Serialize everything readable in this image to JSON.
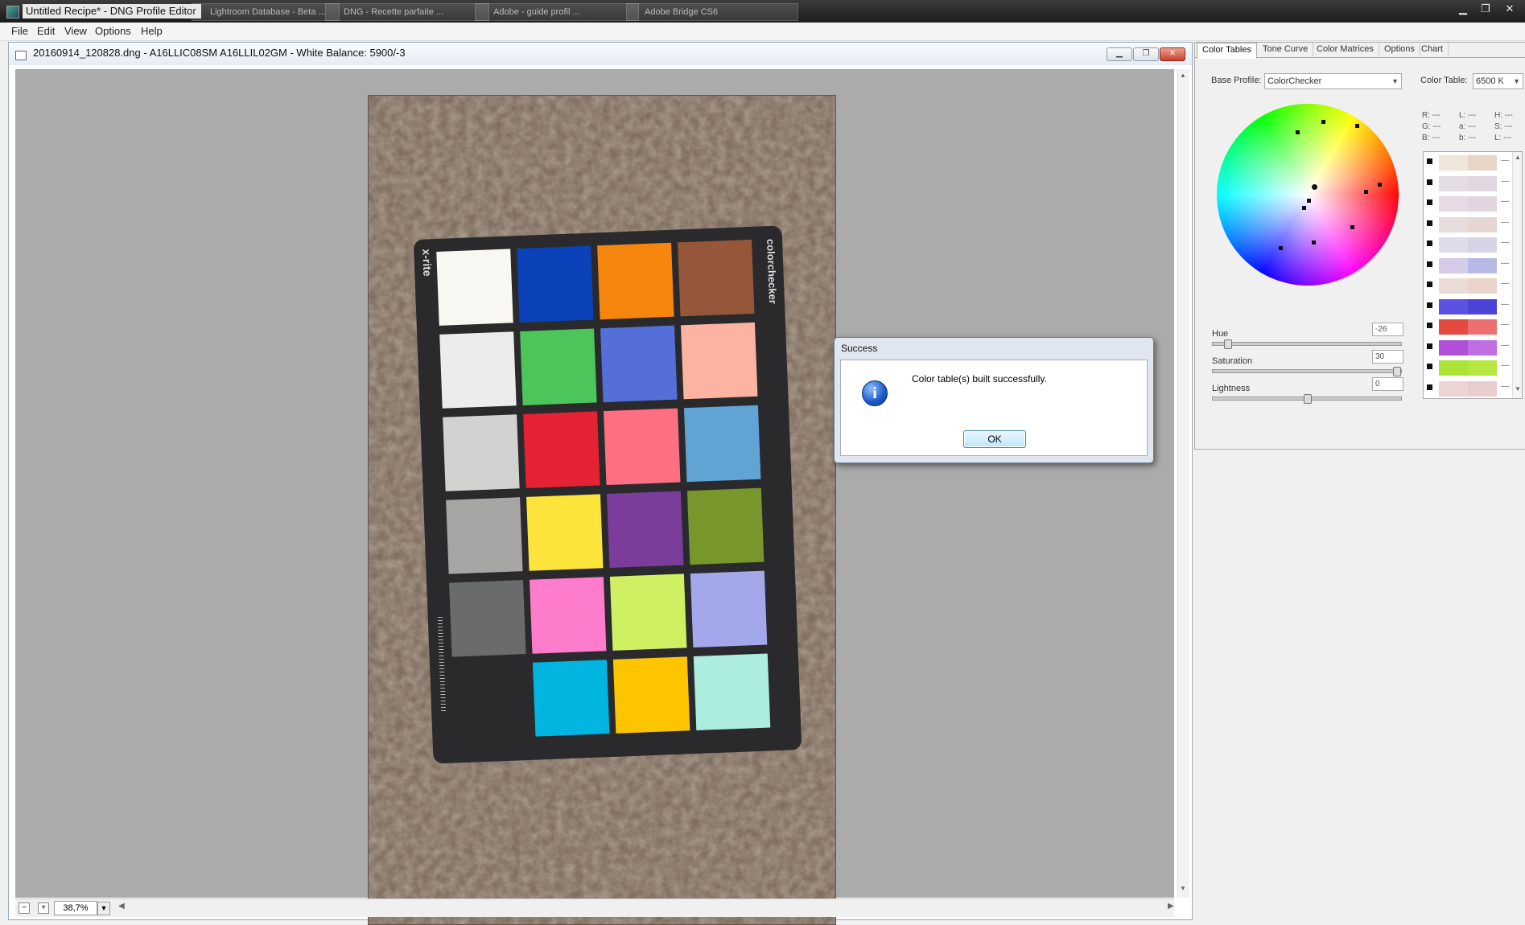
{
  "app": {
    "title": "Untitled Recipe* - DNG Profile Editor"
  },
  "taskbar_tabs": [
    "Lightroom Database - Beta ...",
    "DNG - Recette parfaite ...",
    "Adobe - guide profil ...",
    "Adobe Bridge CS6"
  ],
  "menubar": {
    "items": [
      "File",
      "Edit",
      "View",
      "Options",
      "Help"
    ]
  },
  "document": {
    "title": "20160914_120828.dng  - A16LLIC08SM A16LLIL02GM - White Balance: 5900/-3",
    "zoom": "38,7%"
  },
  "colorchecker": {
    "brand": "x-rite",
    "product": "colorchecker",
    "patches": [
      "#f8f7f2",
      "#0a43b9",
      "#f6860d",
      "#96563a",
      "#ececea",
      "#4cc65a",
      "#5470d8",
      "#fcb3a2",
      "#d2d2d0",
      "#e52234",
      "#ff6f84",
      "#5fa4d4",
      "#a7a6a4",
      "#fde43a",
      "#7b3c9c",
      "#77962b",
      "#6a6b6d",
      "#fe7ccc",
      "#d0f064",
      "#a2a8e9",
      "#2a2a2c",
      "#01b5e1",
      "#fdc500",
      "#acede0"
    ]
  },
  "dialog": {
    "title": "Success",
    "message": "Color table(s) built successfully.",
    "ok_label": "OK",
    "icon": "info-icon"
  },
  "panel": {
    "tabs": [
      "Color Tables",
      "Tone Curve",
      "Color Matrices",
      "Options",
      "Chart"
    ],
    "base_profile_label": "Base Profile:",
    "base_profile_value": "ColorChecker",
    "color_table_label": "Color Table:",
    "color_table_value": "6500 K",
    "readouts": {
      "r_label": "R:",
      "r": "---",
      "g_label": "G:",
      "g": "---",
      "b_label": "B:",
      "b": "---",
      "l_label": "L:",
      "l": "---",
      "a_label": "a:",
      "a": "---",
      "bb_label": "b:",
      "bb": "---",
      "h_label": "H:",
      "h": "---",
      "s_label": "S:",
      "s": "---",
      "l2_label": "L:",
      "l2": "---"
    },
    "hue_label": "Hue",
    "hue_value": "-26",
    "saturation_label": "Saturation",
    "saturation_value": "30",
    "lightness_label": "Lightness",
    "lightness_value": "0",
    "sliders": {
      "hue": 0.06,
      "saturation": 0.99,
      "lightness": 0.5
    },
    "swatches": [
      [
        "#eee6d9",
        "#e7d5c8"
      ],
      [
        "#e5dde5",
        "#e2d6e0"
      ],
      [
        "#e6dbe4",
        "#e2d5df"
      ],
      [
        "#e5dcde",
        "#e6d6d3"
      ],
      [
        "#e0dbe9",
        "#d8d2e6"
      ],
      [
        "#d6cbe8",
        "#b7b8e6"
      ],
      [
        "#eadcd6",
        "#ead3c8"
      ],
      [
        "#5b51e3",
        "#4c43d8"
      ],
      [
        "#e4493f",
        "#eb6f6f"
      ],
      [
        "#b14fd8",
        "#c06ce2"
      ],
      [
        "#a9e436",
        "#b6e640"
      ],
      [
        "#ebd4d3",
        "#e9cdcf"
      ]
    ]
  }
}
